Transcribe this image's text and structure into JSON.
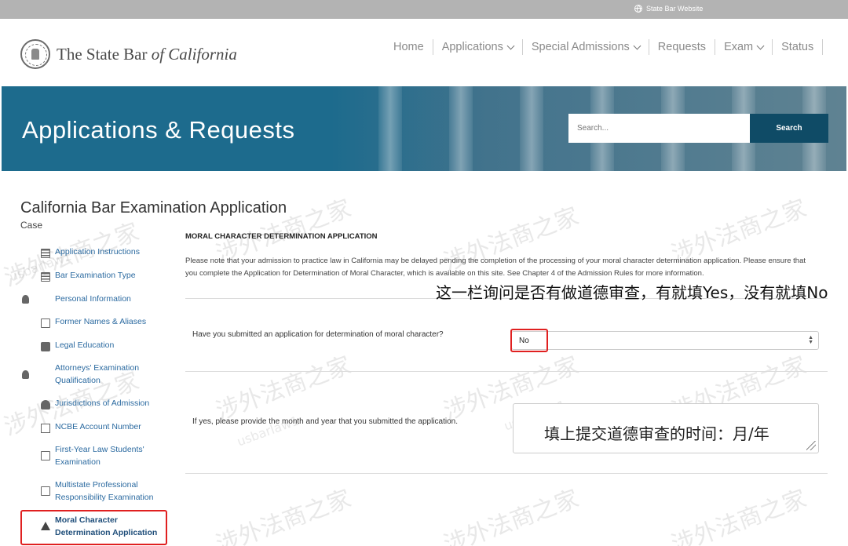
{
  "topbar": {
    "site_link": "State Bar Website",
    "icon": "globe-icon"
  },
  "header": {
    "logo_main": "The State Bar ",
    "logo_italic": "of California",
    "nav": [
      {
        "label": "Home",
        "has_menu": false
      },
      {
        "label": "Applications",
        "has_menu": true
      },
      {
        "label": "Special Admissions",
        "has_menu": true
      },
      {
        "label": "Requests",
        "has_menu": false
      },
      {
        "label": "Exam",
        "has_menu": true
      },
      {
        "label": "Status",
        "has_menu": false
      }
    ]
  },
  "hero": {
    "title": "Applications & Requests",
    "search_placeholder": "Search...",
    "search_button": "Search"
  },
  "page": {
    "title": "California Bar Examination Application",
    "case_label": "Case"
  },
  "sidebar": {
    "items": [
      {
        "label": "Application Instructions",
        "icon": "list-icon"
      },
      {
        "label": "Bar Examination Type",
        "icon": "list-icon"
      },
      {
        "label": "Personal Information",
        "icon": "person-icon"
      },
      {
        "label": "Former Names & Aliases",
        "icon": "id-card-icon"
      },
      {
        "label": "Legal Education",
        "icon": "briefcase-icon"
      },
      {
        "label": "Attorneys' Examination Qualification",
        "icon": "person-key-icon"
      },
      {
        "label": "Jurisdictions of Admission",
        "icon": "gavel-icon"
      },
      {
        "label": "NCBE Account Number",
        "icon": "hash-icon"
      },
      {
        "label": "First-Year Law Students' Examination",
        "icon": "document-edit-icon"
      },
      {
        "label": "Multistate Professional Responsibility Examination",
        "icon": "document-edit-icon"
      },
      {
        "label": "Moral Character Determination Application",
        "icon": "warning-icon",
        "active": true
      }
    ]
  },
  "main": {
    "section_heading": "MORAL CHARACTER DETERMINATION APPLICATION",
    "notice": "Please note that your admission to practice law in California may be delayed pending the completion of the processing of your moral character determination application. Please ensure that you complete the Application for Determination of Moral Character, which is available on this site. See Chapter 4 of the Admission Rules for more information.",
    "question1": "Have you submitted an application for determination of moral character?",
    "question1_value": "No",
    "question2": "If yes, please provide the month and year that you submitted the application.",
    "question2_value": ""
  },
  "annotations": {
    "note1": "这一栏询问是否有做道德审查，有就填Yes，没有就填No",
    "note2": "填上提交道德审查的时间：月/年",
    "highlight_color": "#e02020"
  },
  "watermarks": {
    "text_cn": "涉外法商之家",
    "text_en": "usbarlaw1"
  }
}
